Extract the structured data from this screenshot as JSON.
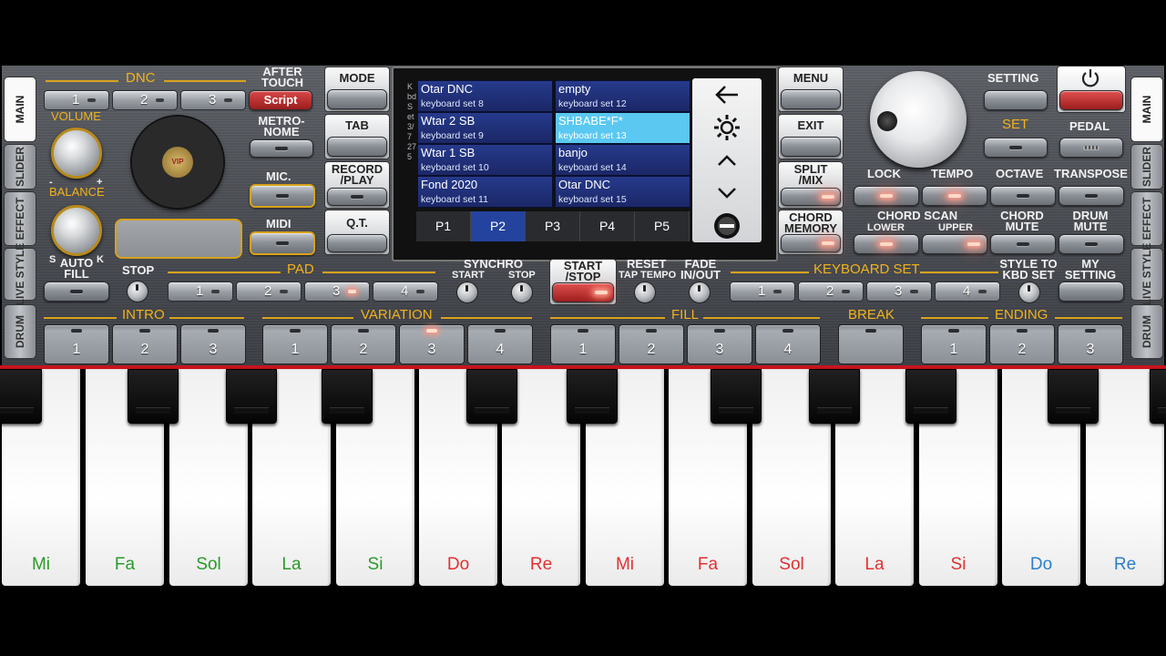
{
  "side_tabs_left": [
    "MAIN",
    "SLIDER",
    "EFFECT",
    "LIVE STYLE",
    "DRUM"
  ],
  "side_tabs_right": [
    "MAIN",
    "SLIDER",
    "EFFECT",
    "LIVE STYLE",
    "DRUM"
  ],
  "dnc": {
    "label": "DNC",
    "buttons": [
      "1",
      "2",
      "3"
    ],
    "script": "Script",
    "after_touch": "AFTER TOUCH"
  },
  "volume": "VOLUME",
  "balance": "BALANCE",
  "balance_minus": "-",
  "balance_plus": "+",
  "balance_s": "S",
  "balance_k": "K",
  "disc_label": "VIP",
  "metronome": "METRO- NOME",
  "mic": "MIC.",
  "midi": "MIDI",
  "center_left_buttons": [
    "MODE",
    "TAB",
    "RECORD /PLAY",
    "Q.T."
  ],
  "screen": {
    "side_text": "Kbd Set 3/7 275",
    "sets": [
      {
        "name": "Otar DNC",
        "sub": "keyboard set 8"
      },
      {
        "name": "empty",
        "sub": "keyboard set 12"
      },
      {
        "name": "Wtar 2 SB",
        "sub": "keyboard set 9"
      },
      {
        "name": "SHBABE*F*",
        "sub": "keyboard set 13"
      },
      {
        "name": "Wtar 1 SB",
        "sub": "keyboard set 10"
      },
      {
        "name": "banjo",
        "sub": "keyboard set 14"
      },
      {
        "name": "Fond 2020",
        "sub": "keyboard set 11"
      },
      {
        "name": "Otar DNC",
        "sub": "keyboard set 15"
      }
    ],
    "selected_index": 3,
    "pages": [
      "P1",
      "P2",
      "P3",
      "P4",
      "P5"
    ],
    "selected_page": 1
  },
  "right_column_buttons": [
    "MENU",
    "EXIT",
    "SPLIT /MIX",
    "CHORD MEMORY"
  ],
  "setting": "SETTING",
  "set": "SET",
  "pedal": "PEDAL",
  "lock": "LOCK",
  "tempo": "TEMPO",
  "octave": "OCTAVE",
  "transpose": "TRANSPOSE",
  "chord_scan": "CHORD SCAN",
  "lower": "LOWER",
  "upper": "UPPER",
  "chord_mute": "CHORD MUTE",
  "drum_mute": "DRUM MUTE",
  "auto_fill": "AUTO FILL",
  "stop": "STOP",
  "pad": {
    "label": "PAD",
    "buttons": [
      "1",
      "2",
      "3",
      "4"
    ]
  },
  "synchro": "SYNCHRO",
  "synchro_start": "START",
  "synchro_stop": "STOP",
  "start_stop": "START /STOP",
  "reset": "RESET",
  "tap_tempo": "TAP TEMPO",
  "fade": "FADE IN/OUT",
  "keyboard_set": {
    "label": "KEYBOARD SET",
    "buttons": [
      "1",
      "2",
      "3",
      "4"
    ]
  },
  "style_to_kbd": "STYLE TO KBD SET",
  "my_setting": "MY SETTING",
  "intro": {
    "label": "INTRO",
    "buttons": [
      "1",
      "2",
      "3"
    ]
  },
  "variation": {
    "label": "VARIATION",
    "buttons": [
      "1",
      "2",
      "3",
      "4"
    ]
  },
  "fill": {
    "label": "FILL",
    "buttons": [
      "1",
      "2",
      "3",
      "4"
    ]
  },
  "break": {
    "label": "BREAK"
  },
  "ending": {
    "label": "ENDING",
    "buttons": [
      "1",
      "2",
      "3"
    ]
  },
  "white_keys": [
    {
      "note": "Mi",
      "color": "green"
    },
    {
      "note": "Fa",
      "color": "green"
    },
    {
      "note": "Sol",
      "color": "green"
    },
    {
      "note": "La",
      "color": "green"
    },
    {
      "note": "Si",
      "color": "green"
    },
    {
      "note": "Do",
      "color": "red"
    },
    {
      "note": "Re",
      "color": "red"
    },
    {
      "note": "Mi",
      "color": "red"
    },
    {
      "note": "Fa",
      "color": "red"
    },
    {
      "note": "Sol",
      "color": "red"
    },
    {
      "note": "La",
      "color": "red"
    },
    {
      "note": "Si",
      "color": "red"
    },
    {
      "note": "Do",
      "color": "blue"
    },
    {
      "note": "Re",
      "color": "blue"
    }
  ],
  "colors": {
    "accent_gold": "#f2b21c",
    "red_line": "#c8141c",
    "selected_set": "#5ac8f0",
    "set_blue": "#263a8c"
  }
}
